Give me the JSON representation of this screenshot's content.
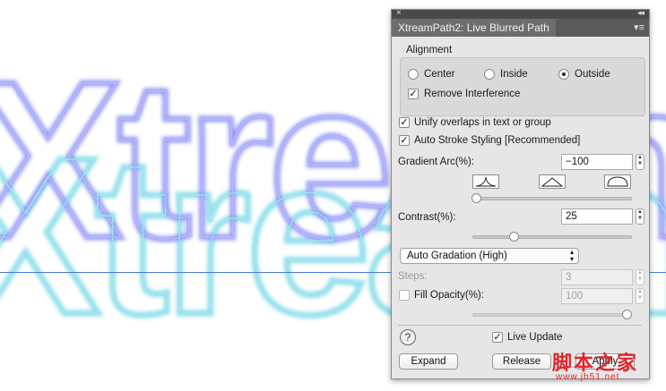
{
  "canvas": {
    "artwork_text": "Xtream",
    "ghost_colors": [
      "#7b7ff0",
      "#6ad6e6"
    ]
  },
  "panel": {
    "title": "XtreamPath2: Live Blurred Path",
    "alignment": {
      "heading": "Alignment",
      "options": [
        "Center",
        "Inside",
        "Outside"
      ],
      "selected": "Outside",
      "remove_interference": "Remove Interference"
    },
    "unify_overlaps": "Unify overlaps in text or group",
    "auto_stroke": "Auto Stroke Styling [Recommended]",
    "gradient_arc": {
      "label": "Gradient Arc(%):",
      "value": "−100",
      "slider_fraction": 0.0
    },
    "contrast": {
      "label": "Contrast(%):",
      "value": "25",
      "slider_fraction": 0.25
    },
    "gradation": {
      "selected": "Auto Gradation (High)"
    },
    "steps": {
      "label": "Steps:",
      "value": "3"
    },
    "fill_opacity": {
      "label": "Fill Opacity(%):",
      "value": "100",
      "slider_fraction": 1.0
    },
    "help": "?",
    "live_update": "Live Update",
    "buttons": {
      "expand": "Expand",
      "release": "Release",
      "apply": "Apply"
    }
  },
  "watermark": {
    "brand": "脚本之家",
    "url": "www.jb51.net"
  },
  "colors": {
    "guide_line": "#4a78d6",
    "panel_bg": "#e6e6e6",
    "tab_bg": "#6d6d6d"
  }
}
